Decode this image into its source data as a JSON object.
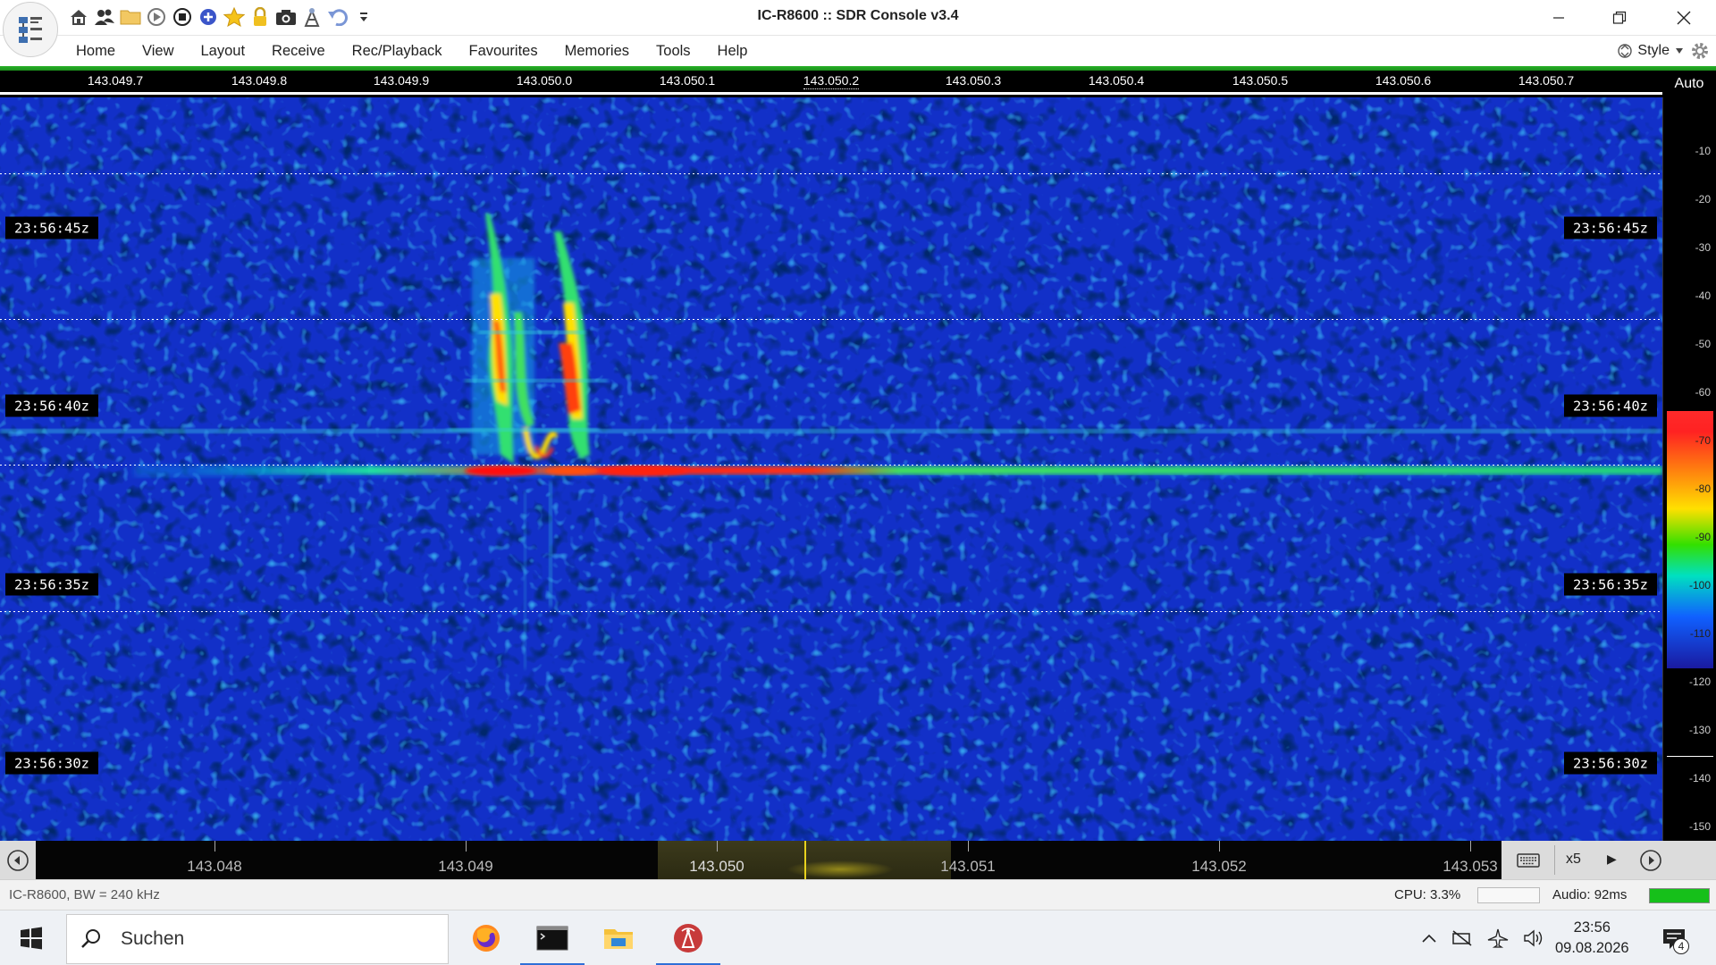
{
  "window": {
    "title": "IC-R8600 :: SDR Console v3.4",
    "controls": [
      "minimize",
      "restore",
      "close"
    ]
  },
  "quick_access_toolbar": [
    {
      "icon": "home-icon"
    },
    {
      "icon": "users-icon"
    },
    {
      "icon": "folder-icon"
    },
    {
      "icon": "play-icon"
    },
    {
      "icon": "stop-icon"
    },
    {
      "icon": "add-icon"
    },
    {
      "icon": "star-icon"
    },
    {
      "icon": "lock-icon"
    },
    {
      "icon": "camera-icon"
    },
    {
      "icon": "radio-tower-icon"
    },
    {
      "icon": "undo-icon"
    },
    {
      "icon": "dropdown-icon"
    }
  ],
  "menu": {
    "items": [
      "Home",
      "View",
      "Layout",
      "Receive",
      "Rec/Playback",
      "Favourites",
      "Memories",
      "Tools",
      "Help"
    ],
    "style_label": "Style"
  },
  "frequency_scale": {
    "labels": [
      "143.049.7",
      "143.049.8",
      "143.049.9",
      "143.050.0",
      "143.050.1",
      "143.050.2",
      "143.050.3",
      "143.050.4",
      "143.050.5",
      "143.050.6",
      "143.050.7"
    ],
    "auto_label": "Auto"
  },
  "waterfall": {
    "time_labels": [
      "23:56:45z",
      "23:56:40z",
      "23:56:35z",
      "23:56:30z"
    ]
  },
  "db_scale": {
    "labels": [
      "-10",
      "-20",
      "-30",
      "-40",
      "-50",
      "-60",
      "-70",
      "-80",
      "-90",
      "-100",
      "-110",
      "-120",
      "-130",
      "-140",
      "-150"
    ]
  },
  "overview": {
    "labels": [
      "143.048",
      "143.049",
      "143.050",
      "143.051",
      "143.052",
      "143.053"
    ],
    "zoom": "x5"
  },
  "status": {
    "device": "IC-R8600, BW = 240 kHz",
    "cpu": "CPU: 3.3%",
    "audio": "Audio: 92ms"
  },
  "taskbar": {
    "search_placeholder": "Suchen",
    "apps": [
      {
        "icon": "firefox-icon"
      },
      {
        "icon": "terminal-icon"
      },
      {
        "icon": "file-explorer-icon"
      },
      {
        "icon": "sdr-console-icon"
      }
    ],
    "time": "23:56",
    "date": "09.08.2026",
    "notification_count": "4"
  },
  "colors": {
    "accent_green": "#1fa31f",
    "waterfall_background": "#0c1fb0",
    "signal_peak": "#ff2020",
    "taskbar_indicator": "#2f6fd8"
  }
}
